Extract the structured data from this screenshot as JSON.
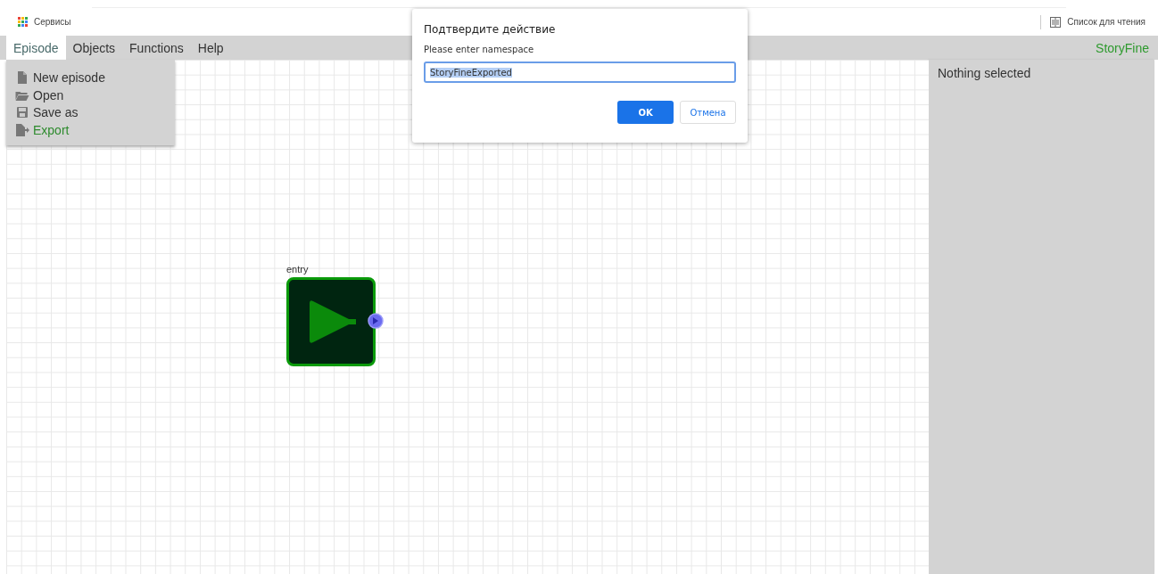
{
  "bookmarks_bar": {
    "apps_label": "Сервисы",
    "reading_list": "Список для чтения"
  },
  "menu_bar": {
    "items": [
      {
        "label": "Episode",
        "selected": true
      },
      {
        "label": "Objects",
        "selected": false
      },
      {
        "label": "Functions",
        "selected": false
      },
      {
        "label": "Help",
        "selected": false
      }
    ],
    "brand": "StoryFine"
  },
  "episode_menu": {
    "items": [
      {
        "label": "New episode",
        "kind": "new",
        "highlighted": false
      },
      {
        "label": "Open",
        "kind": "open",
        "highlighted": false
      },
      {
        "label": "Save as",
        "kind": "save",
        "highlighted": false
      },
      {
        "label": "Export",
        "kind": "export",
        "highlighted": true
      }
    ]
  },
  "canvas": {
    "nodes": [
      {
        "label": "entry",
        "kind": "entry"
      }
    ]
  },
  "inspector": {
    "text": "Nothing selected"
  },
  "dialog": {
    "title": "Подтвердите действие",
    "message": "Please enter namespace",
    "input": {
      "value": "StoryFineExported",
      "text_selected": true
    },
    "buttons": [
      {
        "label": "OK",
        "kind": "primary"
      },
      {
        "label": "Отмена",
        "kind": "secondary"
      }
    ]
  }
}
